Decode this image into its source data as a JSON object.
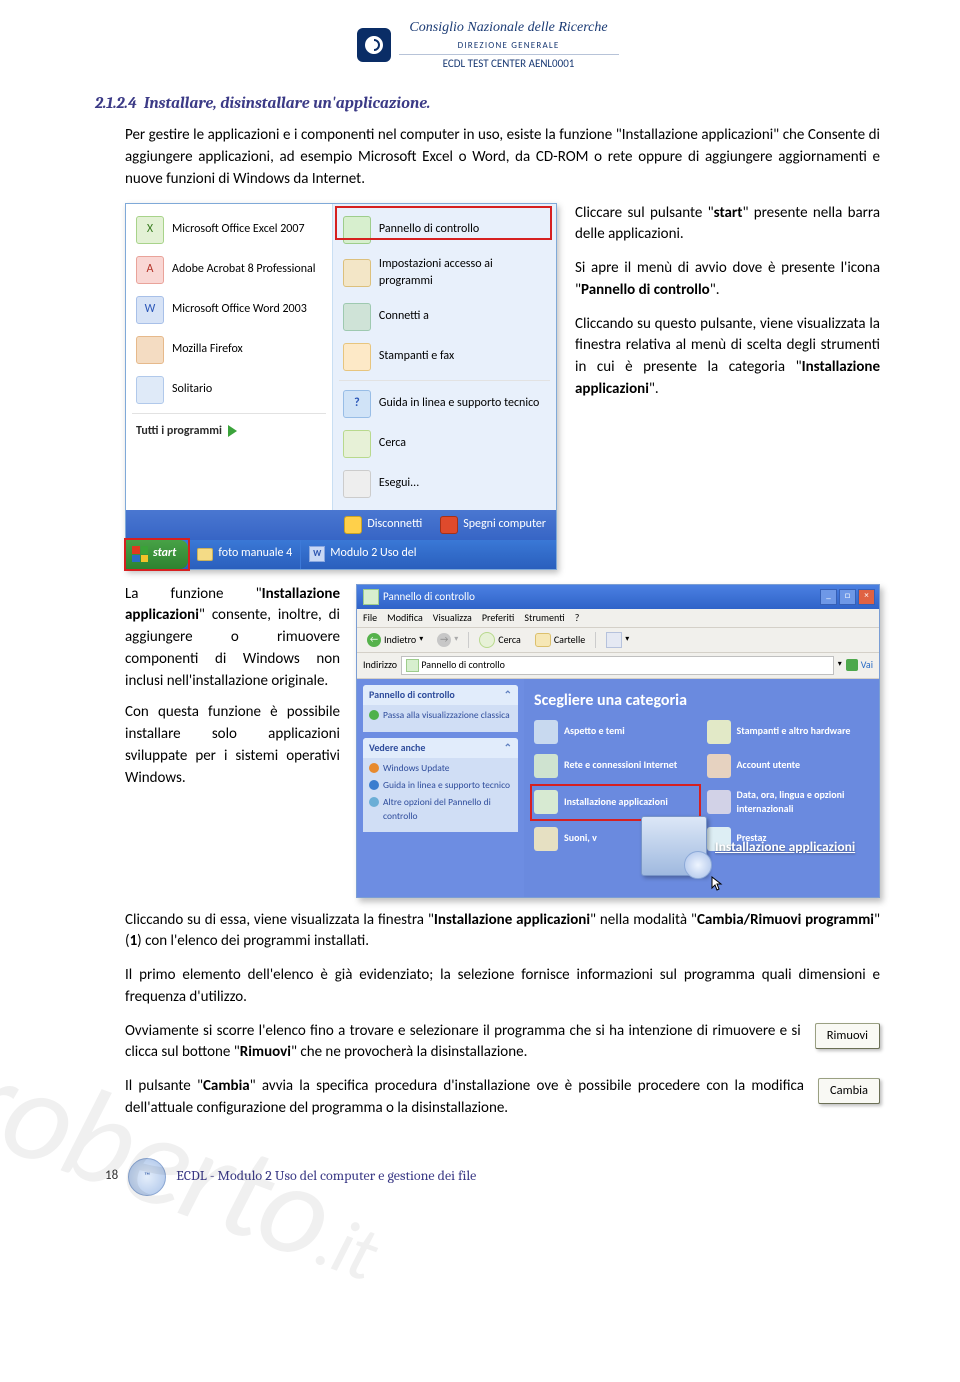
{
  "watermark": "roberto",
  "watermark_suffix": ".it",
  "header": {
    "org": "Consiglio Nazionale delle Ricerche",
    "direction": "DIREZIONE  GENERALE",
    "center": "ECDL TEST CENTER AENL0001"
  },
  "section": {
    "number": "2.1.2.4",
    "title": "Installare, disinstallare un'applicazione."
  },
  "intro": "Per gestire le applicazioni e i componenti nel computer in uso, esiste la funzione \"Installazione applicazioni\" che Consente di aggiungere applicazioni, ad esempio Microsoft Excel o Word, da CD-ROM o rete oppure di aggiungere aggiornamenti e nuove funzioni di Windows da Internet.",
  "side1": {
    "p1_a": "Cliccare sul pulsante \"",
    "p1_b": "start",
    "p1_c": "\" presente nella barra delle applicazioni.",
    "p2_a": "Si apre il menù di avvio dove è presente l'icona \"",
    "p2_b": "Pannello di controllo",
    "p2_c": "\".",
    "p3_a": "Cliccando su questo pulsante, viene visualizzata la finestra relativa al menù di scelta degli strumenti in cui è presente la categoria \"",
    "p3_b": "Installazione applicazioni",
    "p3_c": "\"."
  },
  "xp": {
    "left": {
      "excel": "Microsoft Office Excel 2007",
      "acrobat": "Adobe Acrobat 8 Professional",
      "word": "Microsoft Office Word 2003",
      "firefox": "Mozilla Firefox",
      "solitario": "Solitario",
      "allprog": "Tutti i programmi"
    },
    "right": {
      "panel": "Pannello di controllo",
      "imp": "Impostazioni accesso ai programmi",
      "conn": "Connetti a",
      "fax": "Stampanti e fax",
      "help": "Guida in linea e supporto tecnico",
      "search": "Cerca",
      "run": "Esegui..."
    },
    "off": {
      "disc": "Disconnetti",
      "spegni": "Spegni computer"
    },
    "tb": {
      "start": "start",
      "folder": "foto manuale 4",
      "doc": "Modulo 2 Uso del"
    }
  },
  "side2": {
    "p1_a": "La funzione \"",
    "p1_b": "Installazione applicazioni",
    "p1_c": "\" consente, inoltre, di aggiungere o rimuovere componenti di Windows non inclusi nell'installazione originale.",
    "p2": "Con questa funzione è possibile installare solo applicazioni sviluppate per i sistemi operativi Windows."
  },
  "cp": {
    "title": "Pannello di controllo",
    "menu": {
      "file": "File",
      "modifica": "Modifica",
      "visualizza": "Visualizza",
      "preferiti": "Preferiti",
      "strumenti": "Strumenti",
      "help": "?"
    },
    "toolbar": {
      "back": "Indietro",
      "search": "Cerca",
      "folders": "Cartelle"
    },
    "addr_label": "Indirizzo",
    "addr_value": "Pannello di controllo",
    "go": "Vai",
    "task1_title": "Pannello di controllo",
    "task1_item": "Passa alla visualizzazione classica",
    "task2_title": "Vedere anche",
    "task2_wu": "Windows Update",
    "task2_help": "Guida in linea e supporto tecnico",
    "task2_opt": "Altre opzioni del Pannello di controllo",
    "right_header": "Scegliere una categoria",
    "cats": {
      "app": "Aspetto e temi",
      "print": "Stampanti e altro hardware",
      "net": "Rete e connessioni Internet",
      "acc": "Account utente",
      "install": "Installazione applicazioni",
      "date": "Data, ora, lingua e opzioni internazionali",
      "sound": "Suoni, v",
      "pres": "Prestaz"
    },
    "callout": "Installazione applicazioni"
  },
  "after": {
    "p1_a": "Cliccando su di essa, viene visualizzata la finestra \"",
    "p1_b": "Installazione applicazioni",
    "p1_c": "\" nella modalità \"",
    "p1_d": "Cambia/Rimuovi programmi",
    "p1_e": "\" (",
    "p1_f": "1",
    "p1_g": ") con l'elenco dei programmi installati.",
    "p2": "Il primo elemento dell'elenco è già evidenziato; la selezione fornisce informazioni sul programma quali dimensioni e frequenza d'utilizzo.",
    "p3_a": "Ovviamente si scorre l'elenco fino a trovare e selezionare il programma che si ha intenzione di rimuovere e si clicca sul bottone \"",
    "p3_b": "Rimuovi",
    "p3_c": "\" che ne provocherà la disinstallazione.",
    "btn_rimuovi": "Rimuovi",
    "p4_a": "Il pulsante \"",
    "p4_b": "Cambia",
    "p4_c": "\" avvia la specifica procedura d'installazione ove è possibile procedere con la modifica dell'attuale configurazione del programma o la disinstallazione.",
    "btn_cambia": "Cambia"
  },
  "footer": {
    "page": "18",
    "text": "ECDL - Modulo 2  Uso del computer e gestione dei file"
  }
}
